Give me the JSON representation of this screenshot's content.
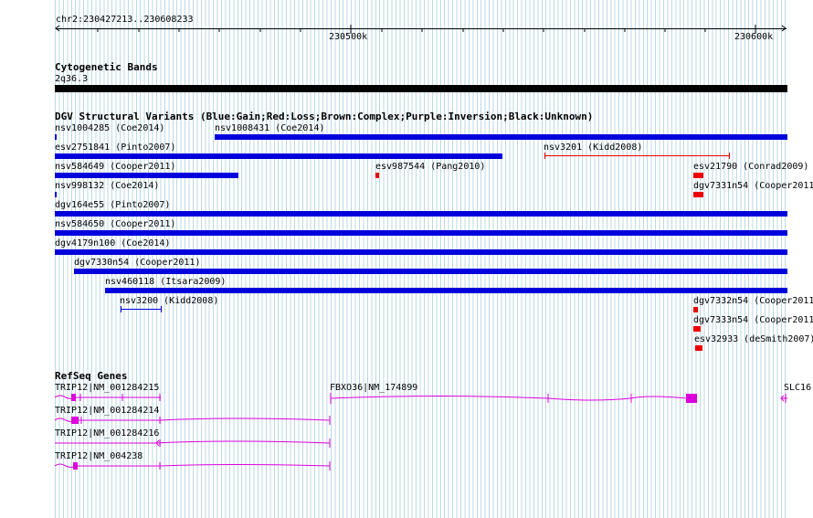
{
  "ruler": {
    "location": "chr2:230427213..230608233",
    "tick_labels": [
      "230500k",
      "230600k"
    ]
  },
  "cytoband": {
    "title": "Cytogenetic Bands",
    "band": "2q36.3"
  },
  "dgv": {
    "title": "DGV Structural Variants (Blue:Gain;Red:Loss;Brown:Complex;Purple:Inversion;Black:Unknown)",
    "features": [
      {
        "label": "nsv1004285 (Coe2014)",
        "type": "gain"
      },
      {
        "label": "nsv1008431 (Coe2014)",
        "type": "gain"
      },
      {
        "label": "esv2751841 (Pinto2007)",
        "type": "gain"
      },
      {
        "label": "nsv3201 (Kidd2008)",
        "type": "loss"
      },
      {
        "label": "nsv584649 (Cooper2011)",
        "type": "gain"
      },
      {
        "label": "esv987544 (Pang2010)",
        "type": "loss"
      },
      {
        "label": "esv21790 (Conrad2009)",
        "type": "loss"
      },
      {
        "label": "nsv998132 (Coe2014)",
        "type": "gain"
      },
      {
        "label": "dgv7331n54 (Cooper2011)",
        "type": "loss"
      },
      {
        "label": "dgv164e55 (Pinto2007)",
        "type": "gain"
      },
      {
        "label": "nsv584650 (Cooper2011)",
        "type": "gain"
      },
      {
        "label": "dgv4179n100 (Coe2014)",
        "type": "gain"
      },
      {
        "label": "dgv7330n54 (Cooper2011)",
        "type": "gain"
      },
      {
        "label": "nsv460118 (Itsara2009)",
        "type": "gain"
      },
      {
        "label": "nsv3200 (Kidd2008)",
        "type": "gain"
      },
      {
        "label": "dgv7332n54 (Cooper2011)",
        "type": "loss"
      },
      {
        "label": "dgv7333n54 (Cooper2011)",
        "type": "loss"
      },
      {
        "label": "esv32933 (deSmith2007)",
        "type": "loss"
      }
    ]
  },
  "refseq": {
    "title": "RefSeq Genes",
    "genes": [
      {
        "label": "TRIP12|NM_001284215"
      },
      {
        "label": "TRIP12|NM_001284214"
      },
      {
        "label": "TRIP12|NM_001284216"
      },
      {
        "label": "TRIP12|NM_004238"
      },
      {
        "label": "FBXO36|NM_174899"
      },
      {
        "label": "SLC16"
      }
    ]
  },
  "colors": {
    "gain": "#0000dd",
    "loss": "#ee0000",
    "gene": "#dd00dd",
    "grid": "#bcd8e6"
  }
}
